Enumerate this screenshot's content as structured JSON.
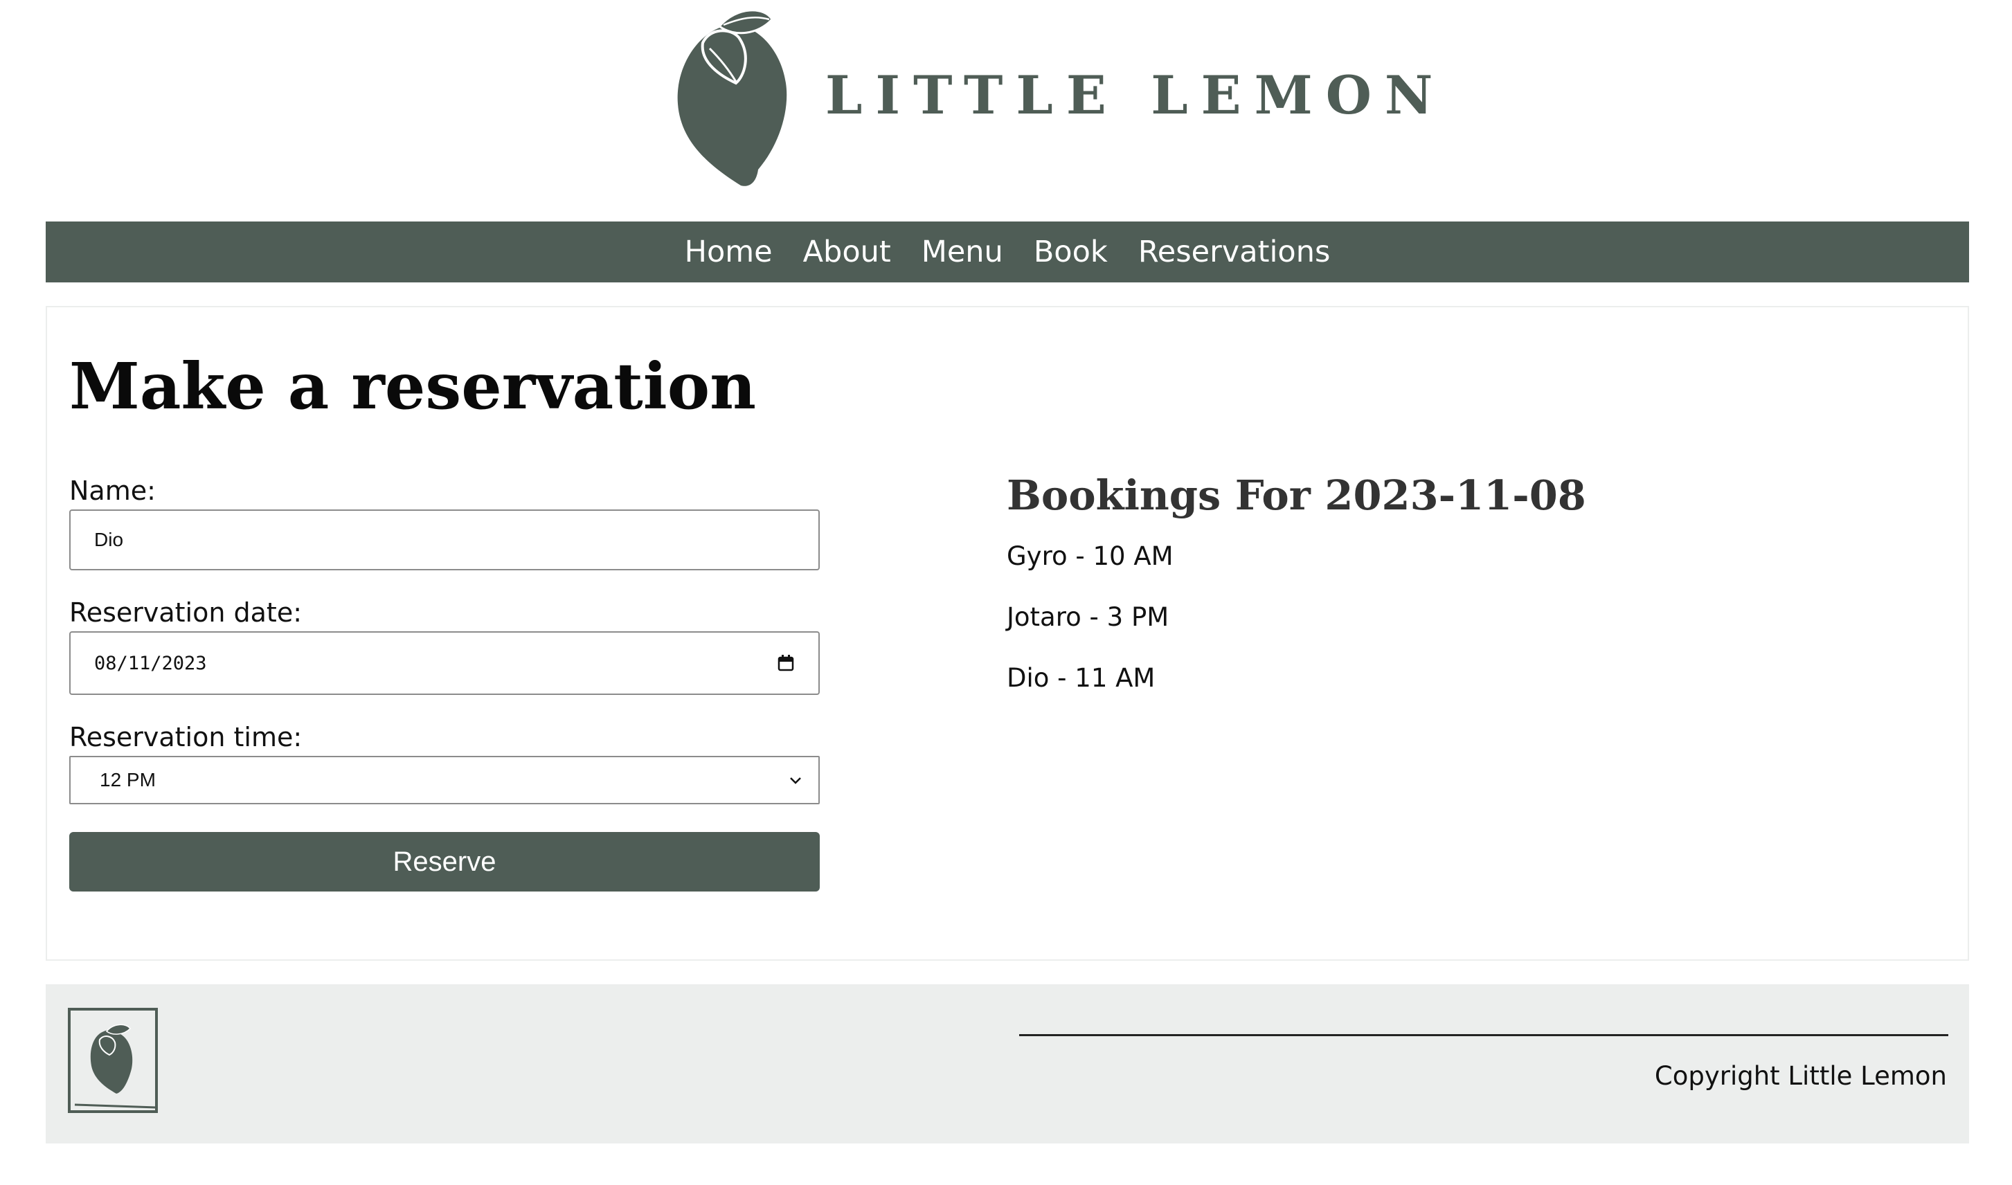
{
  "brand": {
    "name": "LITTLE LEMON",
    "color": "#4f5d56"
  },
  "nav": {
    "items": [
      {
        "label": "Home"
      },
      {
        "label": "About"
      },
      {
        "label": "Menu"
      },
      {
        "label": "Book"
      },
      {
        "label": "Reservations"
      }
    ]
  },
  "main": {
    "title": "Make a reservation",
    "form": {
      "name_label": "Name:",
      "name_value": "Dio",
      "date_label": "Reservation date:",
      "date_value": "08/11/2023",
      "time_label": "Reservation time:",
      "time_value": "12 PM",
      "submit_label": "Reserve"
    },
    "bookings": {
      "title": "Bookings For 2023-11-08",
      "items": [
        {
          "text": "Gyro - 10 AM"
        },
        {
          "text": "Jotaro - 3 PM"
        },
        {
          "text": "Dio - 11 AM"
        }
      ]
    }
  },
  "footer": {
    "copyright": "Copyright Little Lemon",
    "background": "#eceeed"
  },
  "icons": {
    "logo": "lemon-logo-icon",
    "calendar": "calendar-icon",
    "select": "chevron-down-icon",
    "footer_logo": "footer-lemon-logo-icon"
  }
}
